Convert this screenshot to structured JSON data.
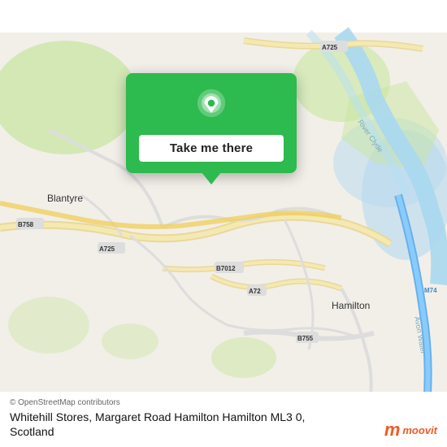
{
  "map": {
    "alt": "OpenStreetMap of Blantyre, Bothwell, Hamilton area, Scotland"
  },
  "popup": {
    "button_label": "Take me there"
  },
  "bottom_bar": {
    "attribution": "© OpenStreetMap contributors",
    "location_name": "Whitehill Stores, Margaret Road Hamilton Hamilton ML3 0, Scotland"
  },
  "moovit_logo": {
    "letter": "m",
    "text": "moovit"
  },
  "colors": {
    "popup_bg": "#2dba4e",
    "moovit_orange": "#f15a24"
  }
}
